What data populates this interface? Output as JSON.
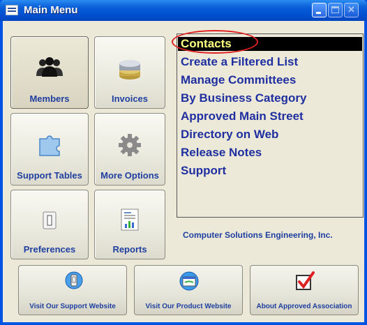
{
  "window": {
    "title": "Main Menu",
    "title_icon": "window-list-icon"
  },
  "tiles": [
    {
      "id": "members",
      "label": "Members",
      "icon": "people-icon"
    },
    {
      "id": "invoices",
      "label": "Invoices",
      "icon": "coins-icon"
    },
    {
      "id": "support_tables",
      "label": "Support Tables",
      "icon": "puzzle-icon"
    },
    {
      "id": "more_options",
      "label": "More Options",
      "icon": "gear-icon"
    },
    {
      "id": "preferences",
      "label": "Preferences",
      "icon": "switch-icon"
    },
    {
      "id": "reports",
      "label": "Reports",
      "icon": "report-icon"
    }
  ],
  "menu": {
    "items": [
      "Contacts",
      "Create a Filtered List",
      "Manage Committees",
      "By Business Category",
      "Approved Main Street",
      "Directory on Web",
      "Release Notes",
      "Support"
    ],
    "active_item": "Contacts"
  },
  "company": "Computer Solutions Engineering, Inc.",
  "bottom_buttons": [
    {
      "label": "Visit Our Support Website",
      "icon": "switch-icon"
    },
    {
      "label": "Visit Our Product Website",
      "icon": "browser-icon"
    },
    {
      "label": "About Approved Association",
      "icon": "checkmark-icon"
    }
  ],
  "colors": {
    "titlebar": "#0a5fd8",
    "label": "#1f3fa0",
    "menu_text": "#1f2fa0",
    "highlight_bg": "#000000",
    "highlight_text": "#ffff80",
    "annotation": "#e02020"
  }
}
